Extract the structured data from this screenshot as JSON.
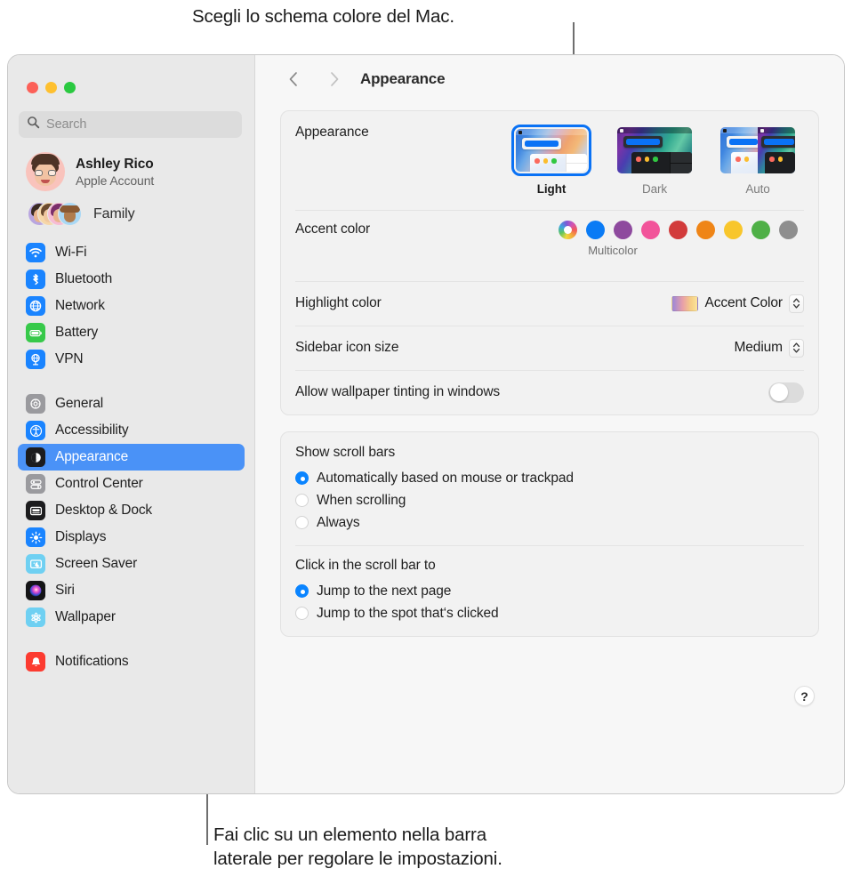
{
  "annotations": {
    "top_caption": "Scegli lo schema colore del Mac.",
    "bottom_caption_line1": "Fai clic su un elemento nella barra",
    "bottom_caption_line2": "laterale per regolare le impostazioni."
  },
  "window": {
    "traffic_lights": [
      "close",
      "minimize",
      "zoom"
    ],
    "toolbar": {
      "back_icon": "chevron-left-icon",
      "forward_icon": "chevron-right-icon",
      "title": "Appearance"
    }
  },
  "sidebar": {
    "search": {
      "placeholder": "Search",
      "icon": "search-icon"
    },
    "account": {
      "name": "Ashley Rico",
      "subtitle": "Apple Account",
      "avatar": "memoji-avatar"
    },
    "family": {
      "label": "Family",
      "icon": "family-avatars"
    },
    "groups": [
      {
        "items": [
          {
            "label": "Wi-Fi",
            "icon": "wifi-icon",
            "color": "#1a84ff",
            "selected": false
          },
          {
            "label": "Bluetooth",
            "icon": "bluetooth-icon",
            "color": "#1a84ff",
            "selected": false
          },
          {
            "label": "Network",
            "icon": "network-globe-icon",
            "color": "#1a84ff",
            "selected": false
          },
          {
            "label": "Battery",
            "icon": "battery-icon",
            "color": "#37c94a",
            "selected": false
          },
          {
            "label": "VPN",
            "icon": "vpn-icon",
            "color": "#1a84ff",
            "selected": false
          }
        ]
      },
      {
        "items": [
          {
            "label": "General",
            "icon": "gear-icon",
            "color": "#8e8e93",
            "selected": false
          },
          {
            "label": "Accessibility",
            "icon": "accessibility-icon",
            "color": "#1a84ff",
            "selected": false
          },
          {
            "label": "Appearance",
            "icon": "appearance-icon",
            "color": "#1c1c1e",
            "selected": true
          },
          {
            "label": "Control Center",
            "icon": "control-center-icon",
            "color": "#8e8e93",
            "selected": false
          },
          {
            "label": "Desktop & Dock",
            "icon": "desktop-dock-icon",
            "color": "#1c1c1e",
            "selected": false
          },
          {
            "label": "Displays",
            "icon": "displays-icon",
            "color": "#1a84ff",
            "selected": false
          },
          {
            "label": "Screen Saver",
            "icon": "screen-saver-icon",
            "color": "#6fd0f2",
            "selected": false
          },
          {
            "label": "Siri",
            "icon": "siri-icon",
            "color": "#1c1c1e",
            "selected": false
          },
          {
            "label": "Wallpaper",
            "icon": "wallpaper-icon",
            "color": "#6fd0f2",
            "selected": false
          }
        ]
      },
      {
        "items": [
          {
            "label": "Notifications",
            "icon": "notifications-icon",
            "color": "#fc3b30",
            "selected": false
          }
        ]
      }
    ]
  },
  "main": {
    "appearance": {
      "label": "Appearance",
      "options": [
        {
          "label": "Light",
          "selected": true
        },
        {
          "label": "Dark",
          "selected": false
        },
        {
          "label": "Auto",
          "selected": false
        }
      ]
    },
    "accent_color": {
      "label": "Accent color",
      "caption": "Multicolor",
      "swatches": [
        {
          "name": "Multicolor",
          "color": "multicolor",
          "selected": true
        },
        {
          "name": "Blue",
          "color": "#0a7bf5"
        },
        {
          "name": "Purple",
          "color": "#8e4a9e"
        },
        {
          "name": "Pink",
          "color": "#f2549a"
        },
        {
          "name": "Red",
          "color": "#d23b3b"
        },
        {
          "name": "Orange",
          "color": "#ef8517"
        },
        {
          "name": "Yellow",
          "color": "#f8c62c"
        },
        {
          "name": "Green",
          "color": "#4fb047"
        },
        {
          "name": "Graphite",
          "color": "#8e8e8e"
        }
      ]
    },
    "highlight_color": {
      "label": "Highlight color",
      "value": "Accent Color",
      "swatch": "accent-gradient"
    },
    "sidebar_icon_size": {
      "label": "Sidebar icon size",
      "value": "Medium"
    },
    "wallpaper_tinting": {
      "label": "Allow wallpaper tinting in windows",
      "enabled": false
    },
    "show_scroll_bars": {
      "label": "Show scroll bars",
      "options": [
        {
          "label": "Automatically based on mouse or trackpad",
          "selected": true
        },
        {
          "label": "When scrolling",
          "selected": false
        },
        {
          "label": "Always",
          "selected": false
        }
      ]
    },
    "click_scroll_bar": {
      "label": "Click in the scroll bar to",
      "options": [
        {
          "label": "Jump to the next page",
          "selected": true
        },
        {
          "label": "Jump to the spot that‘s clicked",
          "selected": false
        }
      ]
    },
    "help_button": "?"
  }
}
